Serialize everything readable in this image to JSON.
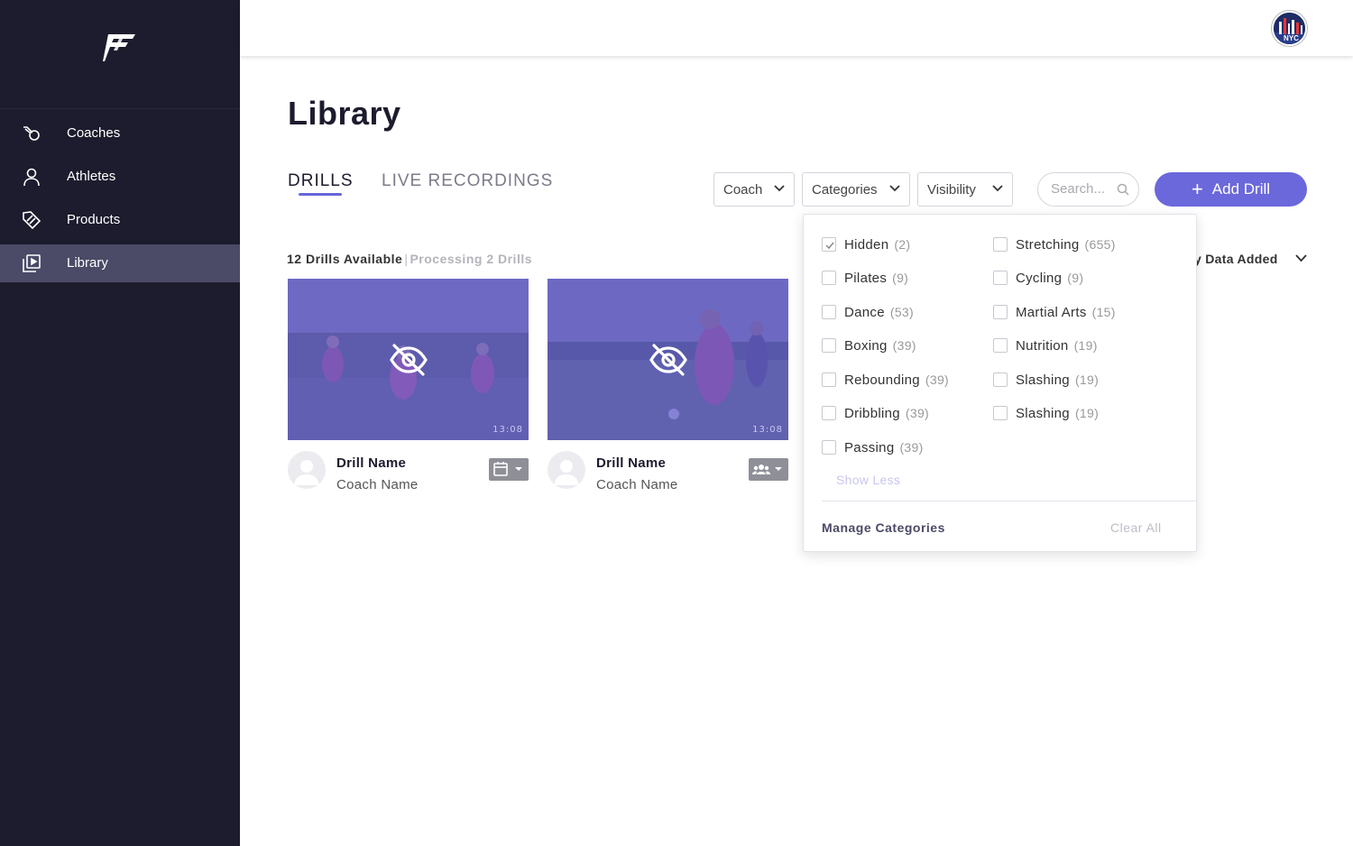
{
  "sidebar": {
    "items": [
      {
        "label": "Coaches",
        "icon": "whistle-icon",
        "active": false
      },
      {
        "label": "Athletes",
        "icon": "person-icon",
        "active": false
      },
      {
        "label": "Products",
        "icon": "tag-icon",
        "active": false
      },
      {
        "label": "Library",
        "icon": "video-library-icon",
        "active": true
      }
    ]
  },
  "topbar": {
    "avatar_text": "NYC"
  },
  "main": {
    "title": "Library",
    "tabs": [
      {
        "label": "DRILLS",
        "active": true
      },
      {
        "label": "LIVE RECORDINGS",
        "active": false
      }
    ],
    "filters": {
      "coach": "Coach",
      "categories": "Categories",
      "visibility": "Visibility"
    },
    "search": {
      "placeholder": "Search..."
    },
    "add_button": {
      "label": "Add Drill"
    },
    "counts": {
      "available": "12 Drills Available",
      "separator": "|",
      "processing": "Processing 2 Drills"
    },
    "sort": {
      "label": "y Data Added"
    },
    "cards": [
      {
        "drill_name": "Drill Name",
        "coach_name": "Coach Name",
        "duration": "13:08",
        "chip_icon": "calendar-icon"
      },
      {
        "drill_name": "Drill Name",
        "coach_name": "Coach Name",
        "duration": "13:08",
        "chip_icon": "group-icon"
      }
    ]
  },
  "categories_dropdown": {
    "left_column": [
      {
        "label": "Hidden",
        "count": "(2)",
        "checked": true
      },
      {
        "label": "Pilates",
        "count": "(9)",
        "checked": false
      },
      {
        "label": "Dance",
        "count": "(53)",
        "checked": false
      },
      {
        "label": "Boxing",
        "count": "(39)",
        "checked": false
      },
      {
        "label": "Rebounding",
        "count": "(39)",
        "checked": false
      },
      {
        "label": "Dribbling",
        "count": "(39)",
        "checked": false
      },
      {
        "label": "Passing",
        "count": "(39)",
        "checked": false
      }
    ],
    "right_column": [
      {
        "label": "Stretching",
        "count": "(655)",
        "checked": false
      },
      {
        "label": "Cycling",
        "count": "(9)",
        "checked": false
      },
      {
        "label": "Martial Arts",
        "count": "(15)",
        "checked": false
      },
      {
        "label": "Nutrition",
        "count": "(19)",
        "checked": false
      },
      {
        "label": "Slashing",
        "count": "(19)",
        "checked": false
      },
      {
        "label": "Slashing",
        "count": "(19)",
        "checked": false
      }
    ],
    "show_less": "Show Less",
    "manage": "Manage Categories",
    "clear_all": "Clear All"
  },
  "colors": {
    "sidebar_bg": "#1d1c2e",
    "sidebar_active": "#4b4a67",
    "accent": "#6b68dc",
    "thumb_overlay": "#625cd2"
  }
}
